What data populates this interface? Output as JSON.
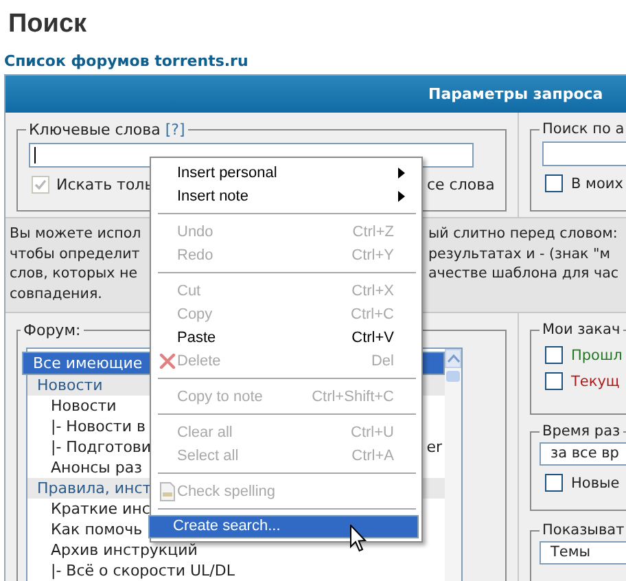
{
  "page_title": "Поиск",
  "breadcrumb": "Список форумов torrents.ru",
  "panel": {
    "header": "Параметры запроса"
  },
  "keywords": {
    "legend": "Ключевые слова",
    "help": "[?]",
    "option": {
      "checked": true,
      "disabled": true,
      "text_start": "Искать толь",
      "text_end": "се слова"
    }
  },
  "author": {
    "legend": "Поиск по а",
    "option": {
      "label": "В моих",
      "checked": false
    }
  },
  "hint": {
    "lines": [
      {
        "start": "Вы можете испол",
        "end": "ый слитно перед словом:"
      },
      {
        "start": "чтобы определит",
        "end": "результатах и - (знак \"м"
      },
      {
        "start": "слов, которых не",
        "end": "ачестве шаблона для час"
      },
      {
        "start": "совпадения."
      }
    ]
  },
  "forum": {
    "legend": "Форум:",
    "items": [
      {
        "label": "Все имеющие",
        "kind": "all",
        "selected": true
      },
      {
        "label": "Новости",
        "kind": "group",
        "selected": false
      },
      {
        "label": "Новости",
        "kind": "forum",
        "selected": false
      },
      {
        "label": "|- Новости в",
        "kind": "forum",
        "selected": false
      },
      {
        "label": "|- Подготови",
        "kind": "forum",
        "selected": false,
        "tail": "er"
      },
      {
        "label": "Анонсы раз",
        "kind": "forum",
        "selected": false
      },
      {
        "label": "Правила, инст",
        "kind": "group",
        "selected": false
      },
      {
        "label": "Краткие инс",
        "kind": "forum",
        "selected": false
      },
      {
        "label": "Как помочь",
        "kind": "forum",
        "selected": false
      },
      {
        "label": "Архив инструкций",
        "kind": "forum",
        "selected": false
      },
      {
        "label": "|- Всё о скорости UL/DL",
        "kind": "forum",
        "selected": false
      }
    ]
  },
  "my_downloads": {
    "legend": "Мои закач",
    "options": [
      {
        "label": "Прошл",
        "checked": false,
        "color": "#1f7a1f"
      },
      {
        "label": "Текущ",
        "checked": false,
        "color": "#b01818"
      }
    ]
  },
  "period": {
    "legend": "Время раз",
    "select": "за все вр",
    "option": {
      "label": "Новые",
      "checked": false
    }
  },
  "show": {
    "legend": "Показыват",
    "select": "Темы"
  },
  "context_menu": {
    "items": [
      {
        "kind": "item",
        "label": "Insert personal",
        "submenu": true,
        "disabled": false,
        "selected": false
      },
      {
        "kind": "item",
        "label": "Insert note",
        "submenu": true,
        "disabled": false,
        "selected": false
      },
      {
        "kind": "separator"
      },
      {
        "kind": "item",
        "label": "Undo",
        "shortcut": "Ctrl+Z",
        "disabled": true,
        "selected": false
      },
      {
        "kind": "item",
        "label": "Redo",
        "shortcut": "Ctrl+Y",
        "disabled": true,
        "selected": false
      },
      {
        "kind": "separator"
      },
      {
        "kind": "item",
        "label": "Cut",
        "shortcut": "Ctrl+X",
        "disabled": true,
        "selected": false
      },
      {
        "kind": "item",
        "label": "Copy",
        "shortcut": "Ctrl+C",
        "disabled": true,
        "selected": false
      },
      {
        "kind": "item",
        "label": "Paste",
        "shortcut": "Ctrl+V",
        "disabled": false,
        "selected": false
      },
      {
        "kind": "erase",
        "label": "Delete",
        "shortcut": "Del",
        "disabled": true,
        "selected": false
      },
      {
        "kind": "separator"
      },
      {
        "kind": "item",
        "label": "Copy to note",
        "shortcut": "Ctrl+Shift+C",
        "disabled": true,
        "selected": false
      },
      {
        "kind": "separator"
      },
      {
        "kind": "item",
        "label": "Clear all",
        "shortcut": "Ctrl+U",
        "disabled": true,
        "selected": false
      },
      {
        "kind": "item",
        "label": "Select all",
        "shortcut": "Ctrl+A",
        "disabled": true,
        "selected": false
      },
      {
        "kind": "separator"
      },
      {
        "kind": "spellcheck",
        "label": "Check spelling",
        "disabled": true,
        "selected": false
      },
      {
        "kind": "separator"
      },
      {
        "kind": "item",
        "label": "Create search...",
        "disabled": false,
        "selected": true
      }
    ]
  }
}
